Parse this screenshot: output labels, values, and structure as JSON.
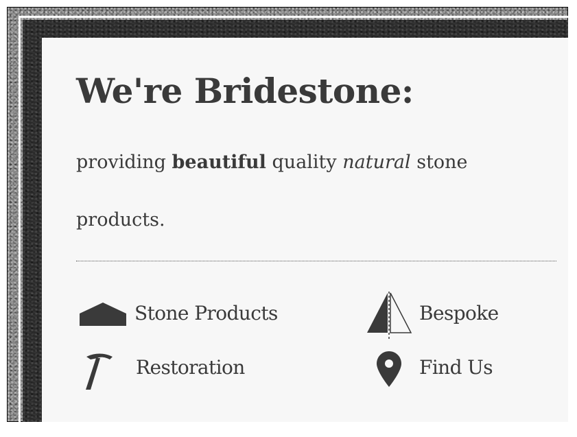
{
  "hero": {
    "heading": "We're Bridestone:",
    "tagline_before": "providing ",
    "tagline_bold": "beautiful",
    "tagline_middle": " quality ",
    "tagline_italic": "natural",
    "tagline_after": " stone products."
  },
  "nav": [
    {
      "label": "Stone Products",
      "icon": "stone-products-icon"
    },
    {
      "label": "Bespoke",
      "icon": "bespoke-icon"
    },
    {
      "label": "Restoration",
      "icon": "hammer-icon"
    },
    {
      "label": "Find Us",
      "icon": "map-pin-icon"
    }
  ],
  "colors": {
    "text": "#3a3a3a",
    "panel": "#f7f7f7",
    "frame_dark": "#2c2c2c",
    "stone": "#8c8c8c"
  }
}
